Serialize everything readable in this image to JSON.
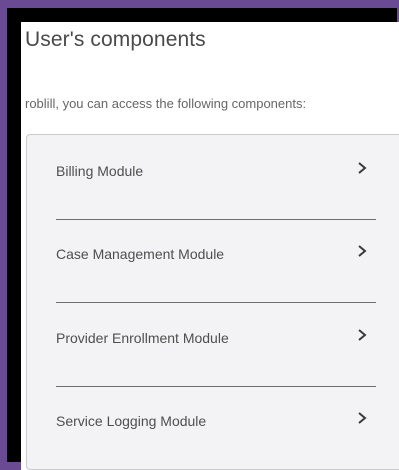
{
  "page": {
    "title": "User's components",
    "intro": "roblill, you can access the following components:"
  },
  "components": [
    {
      "label": "Billing Module",
      "icon": "chevron-right-icon"
    },
    {
      "label": "Case Management Module",
      "icon": "chevron-right-icon"
    },
    {
      "label": "Provider Enrollment Module",
      "icon": "chevron-right-icon"
    },
    {
      "label": "Service Logging Module",
      "icon": "chevron-right-icon"
    }
  ],
  "colors": {
    "frame": "#6a4a93",
    "window": "#000000",
    "card_bg": "#f3f3f5",
    "text": "#4f4f4f"
  }
}
